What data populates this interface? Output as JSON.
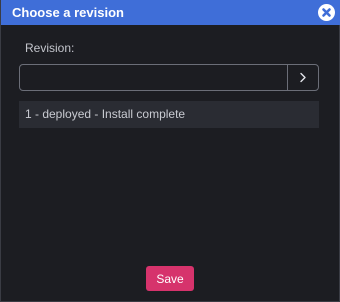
{
  "dialog": {
    "title": "Choose a revision",
    "close_icon": "close-circle-icon",
    "revision_label": "Revision:",
    "revision_input": {
      "value": "",
      "placeholder": ""
    },
    "go_icon": "chevron-right-icon",
    "revisions": [
      {
        "label": "1 - deployed - Install complete"
      }
    ],
    "save_label": "Save"
  },
  "colors": {
    "titlebar": "#3f6ed8",
    "background": "#1c1d22",
    "list_item_bg": "#2a2c33",
    "save_button": "#d6336c"
  }
}
